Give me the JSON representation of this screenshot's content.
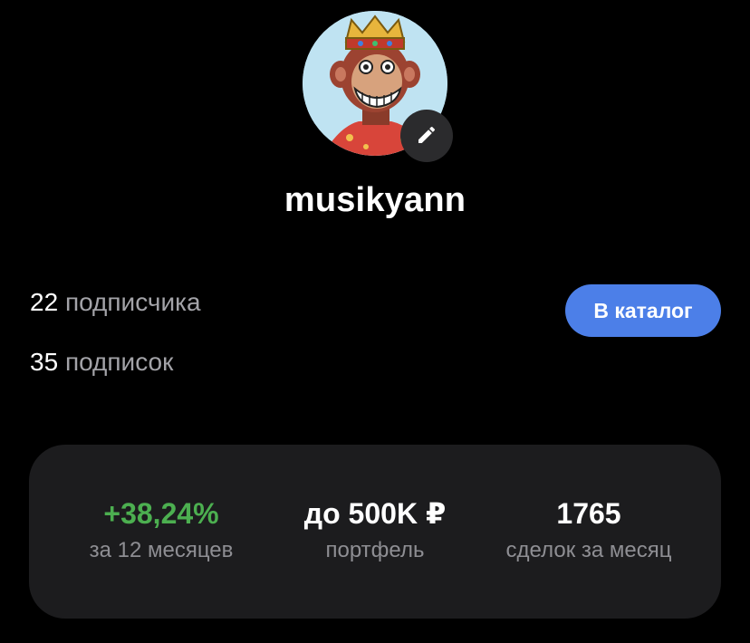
{
  "profile": {
    "username": "musikyann",
    "avatar": "bored-ape-avatar"
  },
  "stats": {
    "followers_count": "22",
    "followers_label": "подписчика",
    "following_count": "35",
    "following_label": "подписок"
  },
  "actions": {
    "catalog_label": "В каталог",
    "edit_icon": "pencil-icon"
  },
  "metrics": [
    {
      "value": "+38,24%",
      "caption": "за 12 месяцев"
    },
    {
      "value": "до 500K ₽",
      "caption": "портфель"
    },
    {
      "value": "1765",
      "caption": "сделок за месяц"
    }
  ],
  "colors": {
    "background": "#000000",
    "card": "#1c1c1e",
    "accent_button": "#4c7fe8",
    "positive": "#4caf50",
    "secondary_text": "#8e8e93"
  }
}
